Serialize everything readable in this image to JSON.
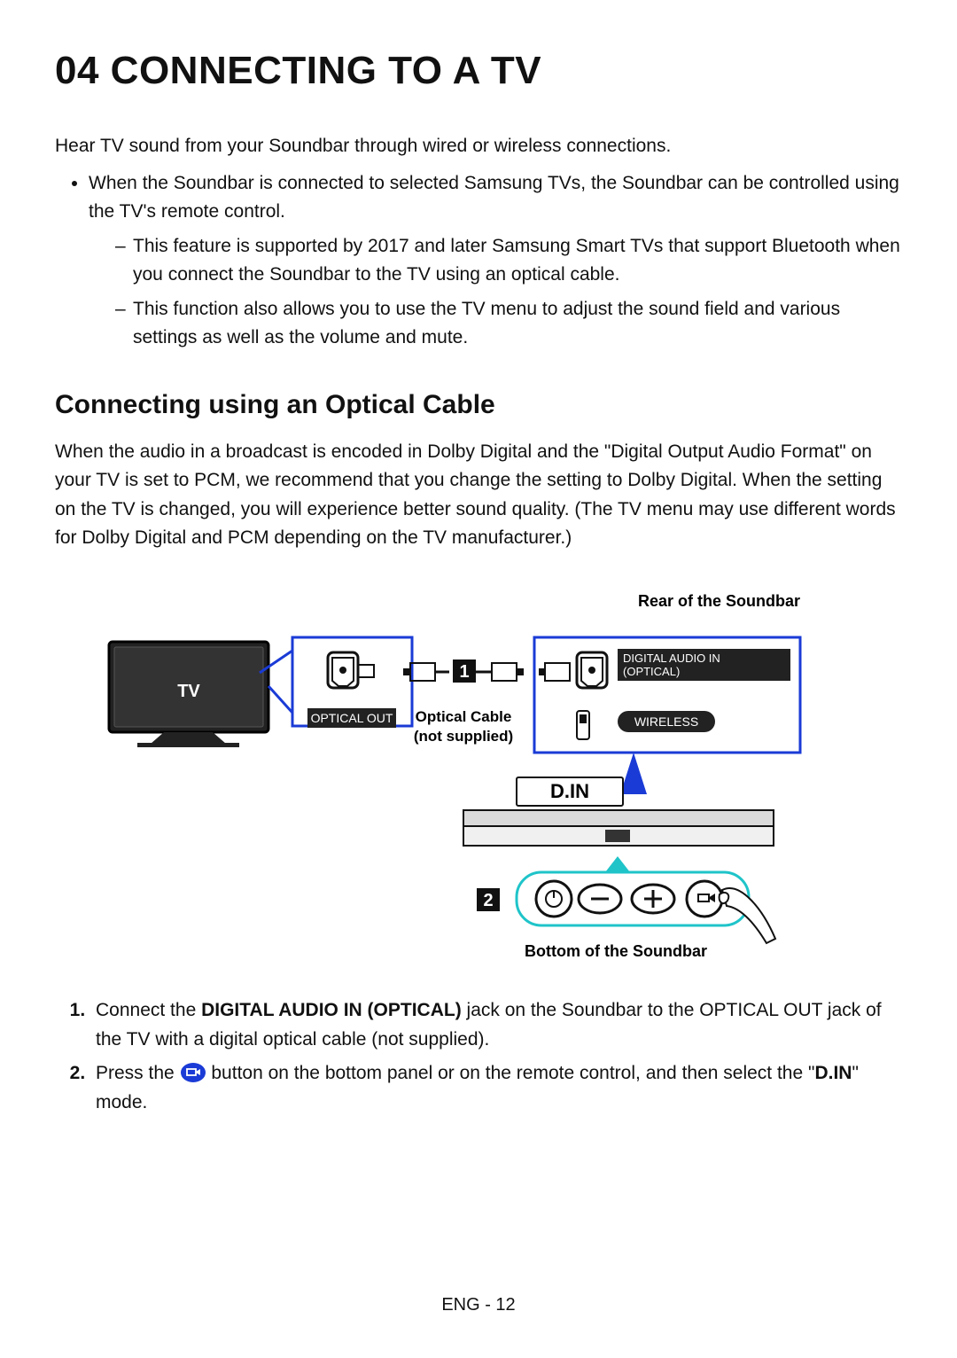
{
  "title": "04   CONNECTING TO A TV",
  "intro": "Hear TV sound from your Soundbar through wired or wireless connections.",
  "bullet1": "When the Soundbar is connected to selected Samsung TVs, the Soundbar can be controlled using the TV's remote control.",
  "dash1": "This feature is supported by 2017 and later Samsung Smart TVs that support Bluetooth when you connect the Soundbar to the TV using an optical cable.",
  "dash2": "This function also allows you to use the TV menu to adjust the sound field and various settings as well as the volume and mute.",
  "subtitle": "Connecting using an Optical Cable",
  "optical_para": "When the audio in a broadcast is encoded in Dolby Digital and the \"Digital Output Audio Format\" on your TV is set to PCM, we recommend that you change the setting to Dolby Digital. When the setting on the TV is changed, you will experience better sound quality. (The TV menu may use different words for Dolby Digital and PCM depending on the TV manufacturer.)",
  "diagram": {
    "rear_label": "Rear of the Soundbar",
    "tv_label": "TV",
    "optical_out": "OPTICAL OUT",
    "optical_cable": "Optical Cable",
    "not_supplied": "(not supplied)",
    "digital_audio_in": "DIGITAL AUDIO IN",
    "digital_audio_in2": "(OPTICAL)",
    "wireless": "WIRELESS",
    "din": "D.IN",
    "bottom_label": "Bottom of the Soundbar",
    "num1": "1",
    "num2": "2"
  },
  "step1_pre": "Connect the ",
  "step1_bold": "DIGITAL AUDIO IN (OPTICAL)",
  "step1_post": " jack on the Soundbar to the OPTICAL OUT jack of the TV with a digital optical cable (not supplied).",
  "step2_pre": "Press the ",
  "step2_mid": " button on the bottom panel or on the remote control, and then select the \"",
  "step2_bold": "D.IN",
  "step2_post": "\" mode.",
  "footer": "ENG - 12"
}
